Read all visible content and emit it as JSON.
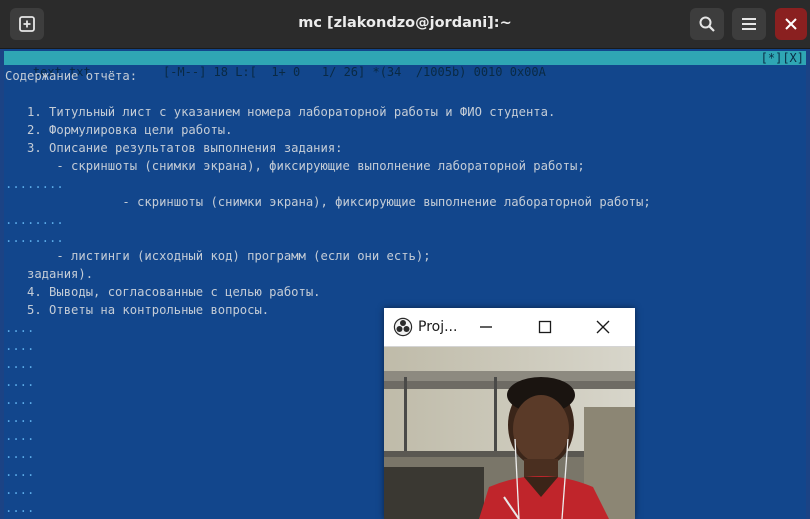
{
  "window": {
    "title": "mc [zlakondzo@jordani]:~",
    "new_tab_icon": "new-tab-icon",
    "search_icon": "search-icon",
    "menu_icon": "hamburger-menu-icon"
  },
  "editor": {
    "status": {
      "filename": "text.txt",
      "info": "[-M--] 18 L:[  1+ 0   1/ 26] *(34  /1005b) 0010 0x00A",
      "controls": "[*][X]"
    },
    "lines": [
      {
        "text": "Содержание отчёта:",
        "dots": false
      },
      {
        "text": "",
        "dots": false
      },
      {
        "text": "   1. Титульный лист с указанием номера лабораторной работы и ФИО студента.",
        "dots": false
      },
      {
        "text": "   2. Формулировка цели работы.",
        "dots": false
      },
      {
        "text": "   3. Описание результатов выполнения задания:",
        "dots": false
      },
      {
        "text": "       - скриншоты (снимки экрана), фиксирующие выполнение лабораторной работы;",
        "dots": false
      },
      {
        "text": "........",
        "dots": true
      },
      {
        "text": "                - скриншоты (снимки экрана), фиксирующие выполнение лабораторной работы;",
        "dots": false
      },
      {
        "text": "........",
        "dots": true
      },
      {
        "text": "........",
        "dots": true
      },
      {
        "text": "       - листинги (исходный код) программ (если они есть);",
        "dots": false
      },
      {
        "text": "   задания).",
        "dots": false
      },
      {
        "text": "   4. Выводы, согласованные с целью работы.",
        "dots": false
      },
      {
        "text": "   5. Ответы на контрольные вопросы.",
        "dots": false
      },
      {
        "text": "....",
        "dots": true
      },
      {
        "text": "....",
        "dots": true
      },
      {
        "text": "....",
        "dots": true
      },
      {
        "text": "....",
        "dots": true
      },
      {
        "text": "....",
        "dots": true
      },
      {
        "text": "....",
        "dots": true
      },
      {
        "text": "....",
        "dots": true
      },
      {
        "text": "....",
        "dots": true
      },
      {
        "text": "....",
        "dots": true
      },
      {
        "text": "....",
        "dots": true
      },
      {
        "text": "....",
        "dots": true
      }
    ]
  },
  "projector": {
    "title": "Proj...",
    "app_icon": "obs-logo-icon",
    "minimize_icon": "minimize-icon",
    "maximize_icon": "maximize-icon",
    "close_icon": "close-icon"
  }
}
